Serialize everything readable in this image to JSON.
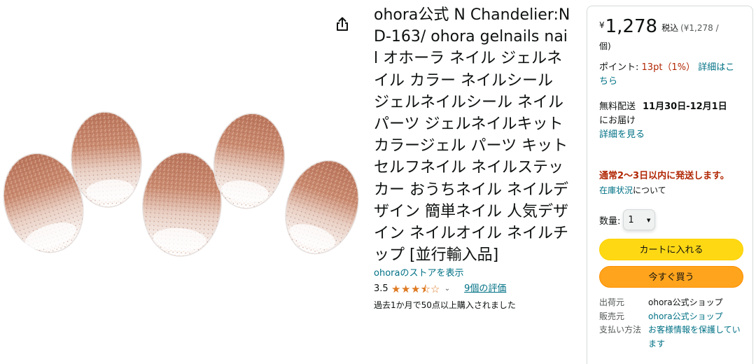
{
  "product": {
    "title": "ohora公式 N Chandelier:ND-163/ ohora gelnails nail オホーラ ネイル ジェルネイル カラー ネイルシール ジェルネイルシール ネイルパーツ ジェルネイルキット カラージェル パーツ キット セルフネイル ネイルステッカー おうちネイル ネイルデザイン 簡単ネイル 人気デザイン ネイルオイル ネイルチップ [並行輸入品]",
    "store_link": "ohoraのストアを表示",
    "rating": "3.5",
    "rating_value": 3.5,
    "review_count": "9個の評価",
    "bought_text": "過去1か月で50点以上購入されました"
  },
  "buybox": {
    "price_symbol": "¥",
    "price_whole": "1,278",
    "price_tax": "税込",
    "price_unit": "(¥1,278 /",
    "price_unit2": "個)",
    "points_label": "ポイント:",
    "points_value": "13pt（1%）",
    "points_link": "詳細はこちら",
    "delivery_label": "無料配送",
    "delivery_dates": "11月30日-12月1日",
    "delivery_suffix": "にお届け",
    "delivery_link": "詳細を見る",
    "ship_note": "通常2～3日以内に発送します。",
    "stock_link": "在庫状況",
    "stock_suffix": "について",
    "qty_label": "数量:",
    "qty_value": "1",
    "cart_button": "カートに入れる",
    "buy_button": "今すぐ買う",
    "seller_rows": [
      {
        "key": "出荷元",
        "value": "ohora公式ショップ"
      },
      {
        "key": "販売元",
        "value": "ohora公式ショップ"
      },
      {
        "key": "支払い方法",
        "value": "お客様情報を保護しています"
      }
    ]
  },
  "icons": {
    "share": "share-icon",
    "star": "star-icon",
    "chevron": "chevron-down-icon"
  },
  "colors": {
    "link": "#007185",
    "price_red": "#b12704",
    "star": "#de7921",
    "cart_yellow": "#ffd814",
    "buy_orange": "#ffa41c"
  }
}
